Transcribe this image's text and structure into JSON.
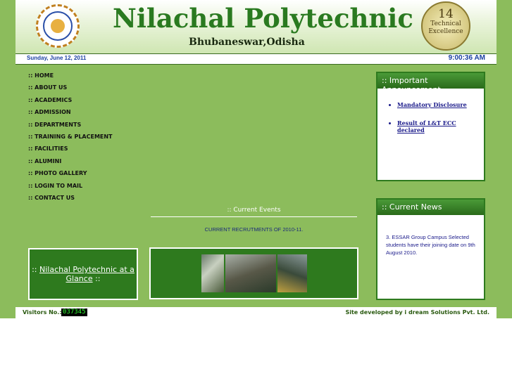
{
  "header": {
    "title": "Nilachal Polytechnic",
    "subtitle": "Bhubaneswar,Odisha",
    "logo_text": "Nilachal Polytechnic Bhubaneswar, Odisha",
    "badge_number": "14",
    "badge_text": "Technical Excellence"
  },
  "datebar": {
    "date": "Sunday, June 12, 2011",
    "time": "9:00:36 AM"
  },
  "nav": [
    ":: HOME",
    ":: ABOUT US",
    ":: ACADEMICS",
    ":: ADMISSION",
    ":: DEPARTMENTS",
    ":: TRAINING & PLACEMENT",
    ":: FACILITIES",
    ":: ALUMINI",
    ":: PHOTO GALLERY",
    ":: LOGIN TO MAIL",
    ":: CONTACT US"
  ],
  "announcements": {
    "title": ":: Important Announcement",
    "items": [
      "Mandatory Disclosure",
      "Result of L&T ECC declared"
    ]
  },
  "news": {
    "title": ":: Current News",
    "text": "3. ESSAR Group Campus Selected students have their joining date on 9th August 2010."
  },
  "events": {
    "title": ":: Current Events",
    "item": "CURRENT RECRUTMENTS OF 2010-11."
  },
  "glance": {
    "prefix": "::",
    "link": "Nilachal Polytechnic at a Glance",
    "suffix": "::"
  },
  "footer": {
    "visitors_label": "Visitors No.:",
    "counter": "037345",
    "credit": "Site developed by i dream Solutions Pvt. Ltd."
  },
  "colors": {
    "page_green": "#8cbc5c",
    "panel_green": "#2e7a1e",
    "title_green": "#2a7a20",
    "link_blue": "#1a1a8a"
  }
}
